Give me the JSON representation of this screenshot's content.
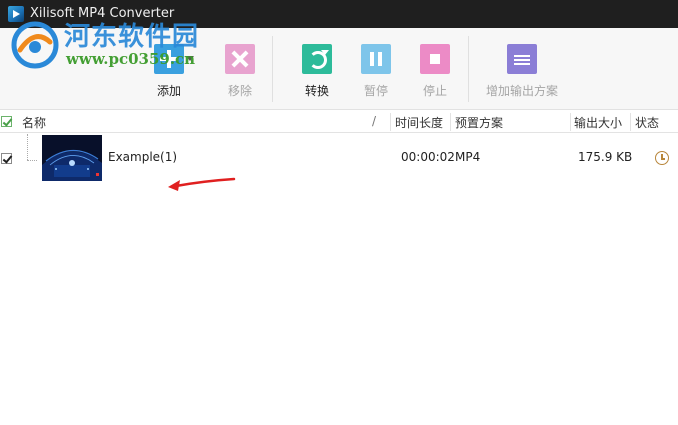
{
  "window": {
    "title": "Xilisoft MP4 Converter",
    "app_icon": "app-icon"
  },
  "watermark": {
    "text": "河东软件园",
    "url": "www.pc0359.cn"
  },
  "toolbar": {
    "add_label": "添加",
    "remove_label": "移除",
    "convert_label": "转换",
    "pause_label": "暂停",
    "stop_label": "停止",
    "add_profile_label": "增加输出方案",
    "colors": {
      "add": "#3aa0df",
      "remove": "#e8a3cf",
      "convert": "#2dbb9a",
      "pause": "#7ec5ea",
      "stop": "#ec8bc6",
      "profile": "#8b7ed6"
    }
  },
  "columns": {
    "name": "名称",
    "duration": "时间长度",
    "profile": "预置方案",
    "size": "输出大小",
    "status": "状态"
  },
  "files": [
    {
      "name": "Example(1)",
      "duration": "00:00:02",
      "profile": "MP4",
      "size": "175.9 KB",
      "status_icon": "clock-icon",
      "checked": true
    }
  ],
  "annotation": {
    "arrow_color": "#e02020"
  }
}
